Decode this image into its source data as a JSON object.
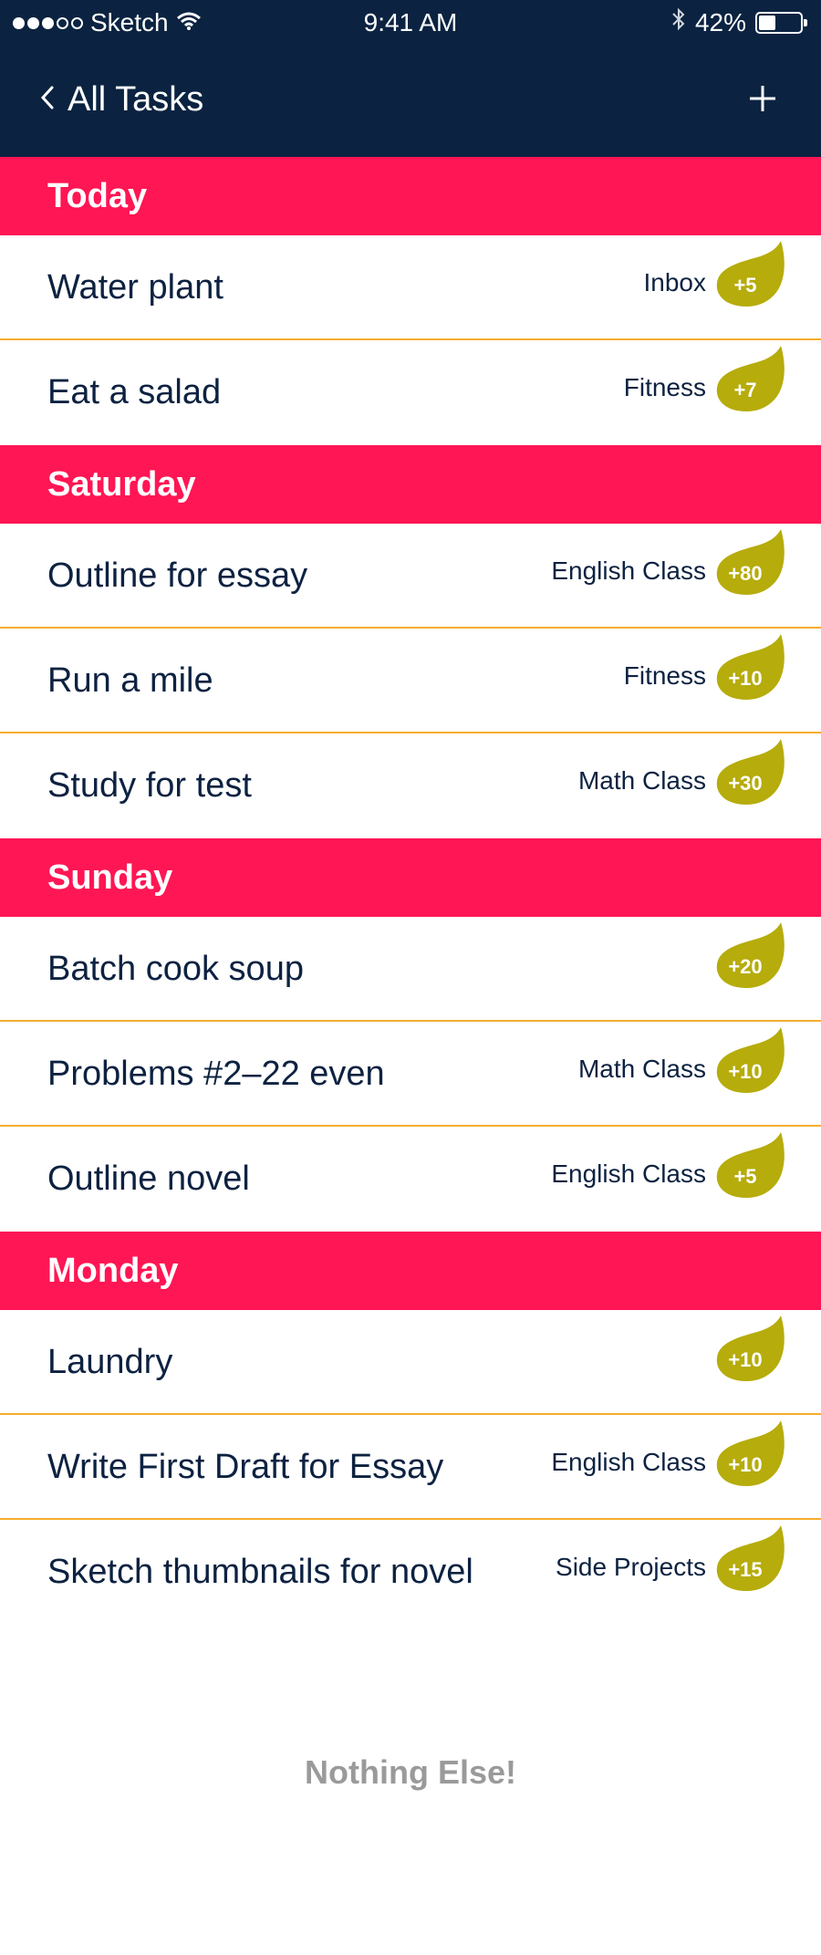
{
  "status_bar": {
    "carrier": "Sketch",
    "time": "9:41 AM",
    "battery": "42%",
    "battery_level": 0.42
  },
  "nav": {
    "back_label": "All Tasks",
    "add_icon": "plus-icon"
  },
  "sections": [
    {
      "title": "Today",
      "tasks": [
        {
          "title": "Water plant",
          "project": "Inbox",
          "points": "+5"
        },
        {
          "title": "Eat a salad",
          "project": "Fitness",
          "points": "+7"
        }
      ]
    },
    {
      "title": "Saturday",
      "tasks": [
        {
          "title": "Outline for essay",
          "project": "English Class",
          "points": "+80"
        },
        {
          "title": "Run a mile",
          "project": "Fitness",
          "points": "+10"
        },
        {
          "title": "Study for test",
          "project": "Math Class",
          "points": "+30"
        }
      ]
    },
    {
      "title": "Sunday",
      "tasks": [
        {
          "title": "Batch cook soup",
          "project": "",
          "points": "+20"
        },
        {
          "title": "Problems #2–22 even",
          "project": "Math Class",
          "points": "+10"
        },
        {
          "title": "Outline novel",
          "project": "English Class",
          "points": "+5"
        }
      ]
    },
    {
      "title": "Monday",
      "tasks": [
        {
          "title": "Laundry",
          "project": "",
          "points": "+10"
        },
        {
          "title": "Write First Draft for Essay",
          "project": "English Class",
          "points": "+10"
        },
        {
          "title": "Sketch thumbnails for novel",
          "project": "Side Projects",
          "points": "+15"
        }
      ]
    }
  ],
  "footer": {
    "message": "Nothing Else!"
  },
  "colors": {
    "nav_bg": "#0b2341",
    "section_bg": "#ff1654",
    "divider": "#f6ad2f",
    "badge": "#b6ac0b"
  }
}
